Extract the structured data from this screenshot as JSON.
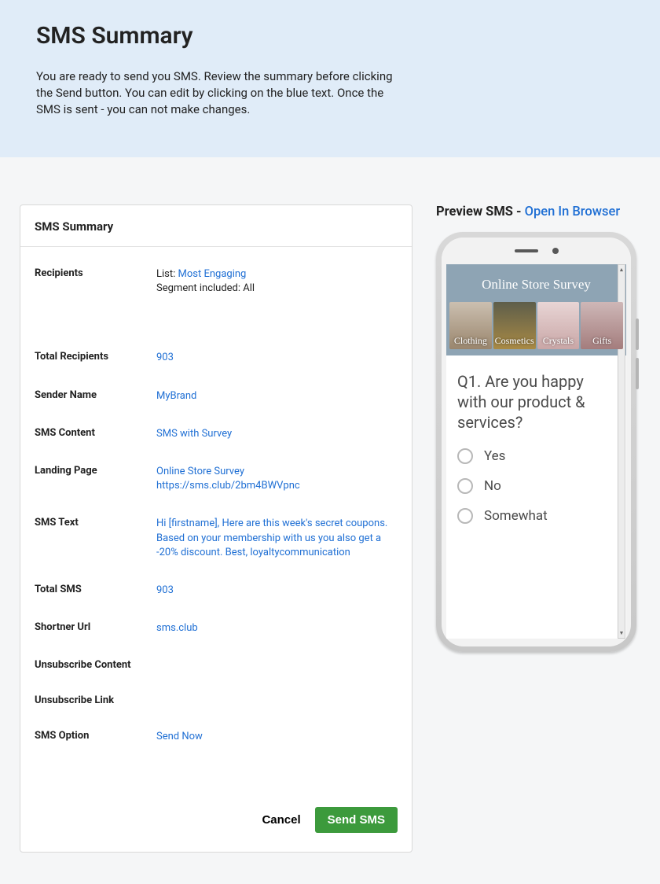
{
  "header": {
    "title": "SMS Summary",
    "description": "You are ready to send you SMS. Review the summary before clicking the Send button. You can edit by clicking on the blue text. Once the SMS is sent - you can not make changes."
  },
  "card": {
    "title": "SMS Summary",
    "recipients": {
      "label": "Recipients",
      "list_prefix": "List: ",
      "list_name": "Most Engaging",
      "segment_line": "Segment included: All"
    },
    "total_recipients": {
      "label": "Total Recipients",
      "value": "903"
    },
    "sender_name": {
      "label": "Sender Name",
      "value": "MyBrand"
    },
    "sms_content": {
      "label": "SMS Content",
      "value": "SMS with Survey"
    },
    "landing_page": {
      "label": "Landing Page",
      "name": "Online Store Survey",
      "url": "https://sms.club/2bm4BWVpnc"
    },
    "sms_text": {
      "label": "SMS Text",
      "value": "Hi [firstname], Here are this week's secret coupons. Based on your membership with us you also get a -20% discount. Best, loyaltycommunication"
    },
    "total_sms": {
      "label": "Total SMS",
      "value": "903"
    },
    "shortner_url": {
      "label": "Shortner Url",
      "value": "sms.club"
    },
    "unsubscribe_content": {
      "label": "Unsubscribe Content",
      "value": ""
    },
    "unsubscribe_link": {
      "label": "Unsubscribe Link",
      "value": ""
    },
    "sms_option": {
      "label": "SMS Option",
      "value": "Send Now"
    },
    "actions": {
      "cancel": "Cancel",
      "send": "Send SMS"
    }
  },
  "preview": {
    "title_prefix": "Preview SMS - ",
    "open_link": "Open In Browser",
    "survey": {
      "hero_title": "Online Store Survey",
      "categories": [
        "Clothing",
        "Cosmetics",
        "Crystals",
        "Gifts"
      ],
      "question": "Q1. Are you happy with our product & services?",
      "options": [
        "Yes",
        "No",
        "Somewhat"
      ]
    }
  }
}
